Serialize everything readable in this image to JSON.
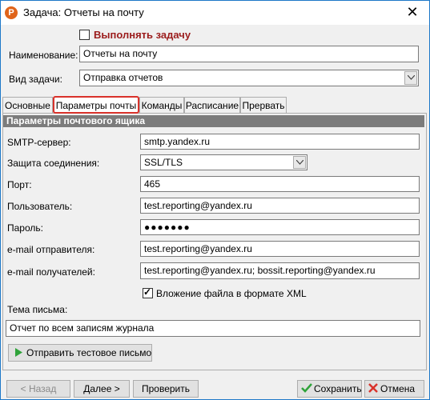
{
  "window": {
    "title": "Задача: Отчеты на почту",
    "app_icon_glyph": "P"
  },
  "task": {
    "execute_label": "Выполнять задачу",
    "execute_checked": false,
    "name_label": "Наименование:",
    "name_value": "Отчеты на почту",
    "type_label": "Вид задачи:",
    "type_value": "Отправка отчетов"
  },
  "tabs": [
    {
      "label": "Основные"
    },
    {
      "label": "Параметры почты"
    },
    {
      "label": "Команды"
    },
    {
      "label": "Расписание"
    },
    {
      "label": "Прервать"
    }
  ],
  "mail": {
    "section_title": "Параметры почтового ящика",
    "smtp_label": "SMTP-сервер:",
    "smtp_value": "smtp.yandex.ru",
    "security_label": "Защита соединения:",
    "security_value": "SSL/TLS",
    "port_label": "Порт:",
    "port_value": "465",
    "user_label": "Пользователь:",
    "user_value": "test.reporting@yandex.ru",
    "password_label": "Пароль:",
    "password_value": "●●●●●●●",
    "sender_label": "e-mail отправителя:",
    "sender_value": "test.reporting@yandex.ru",
    "recipients_label": "e-mail получателей:",
    "recipients_value": "test.reporting@yandex.ru; bossit.reporting@yandex.ru",
    "xml_label": "Вложение файла в формате XML",
    "xml_checked": true,
    "subject_label": "Тема письма:",
    "subject_value": "Отчет по всем записям журнала",
    "test_button": "Отправить тестовое письмо"
  },
  "footer": {
    "back": "< Назад",
    "next": "Далее >",
    "check": "Проверить",
    "save": "Сохранить",
    "cancel": "Отмена"
  },
  "colors": {
    "accent_border": "#1e78c8",
    "active_tab_outline": "#d9322b",
    "section_header": "#7c7c7c"
  }
}
